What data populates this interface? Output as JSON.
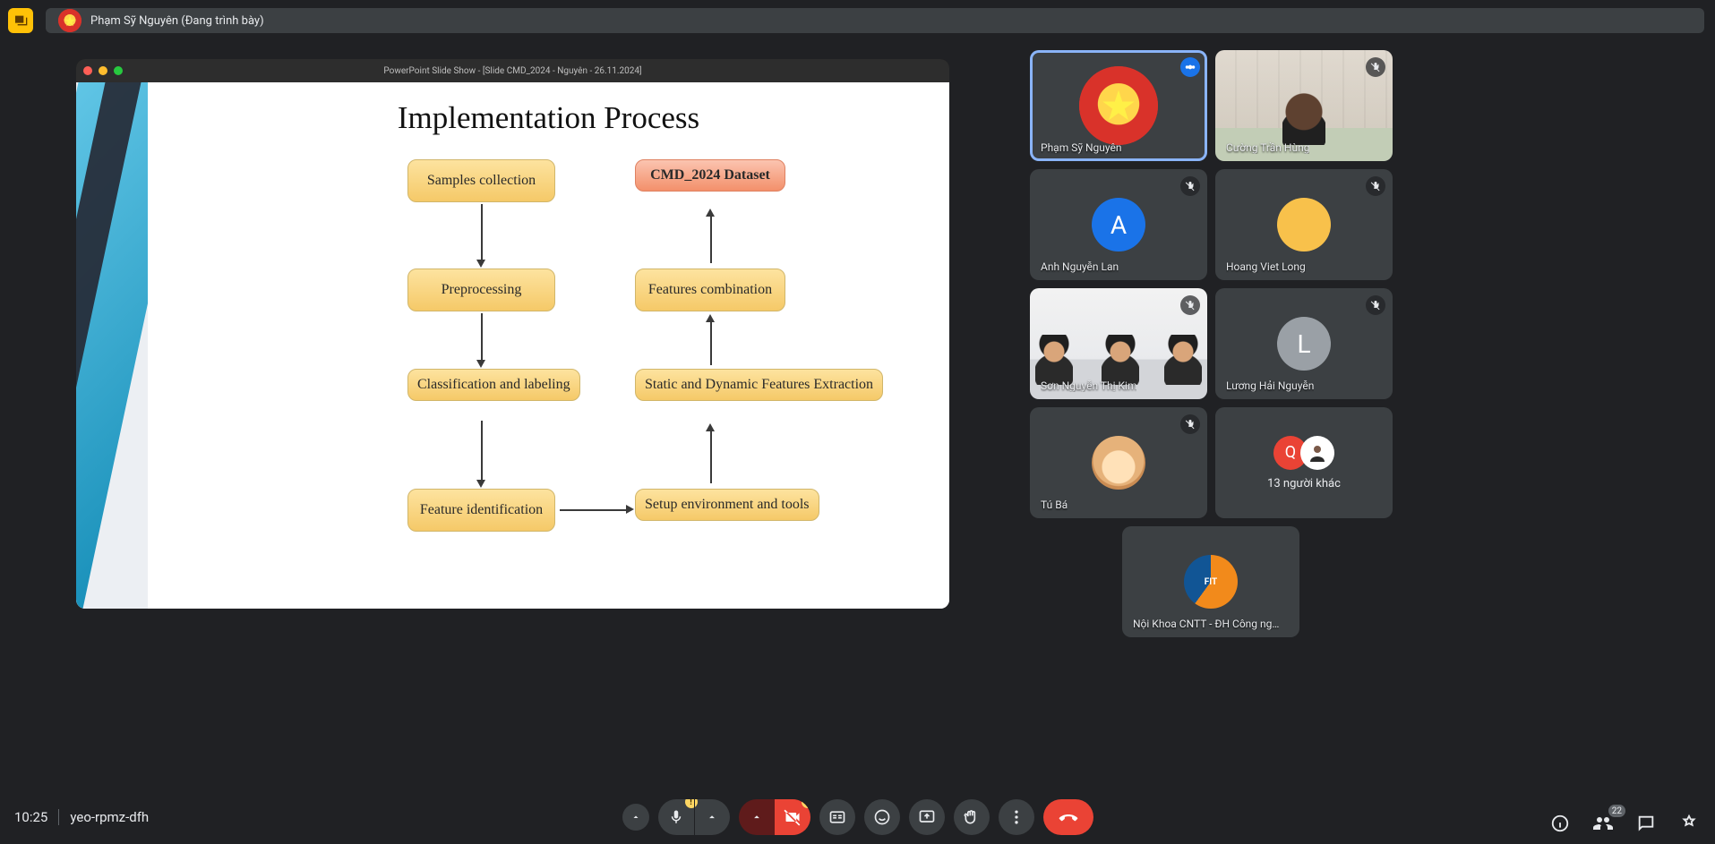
{
  "header": {
    "presenter_label": "Phạm Sỹ Nguyên (Đang trình bày)"
  },
  "presentation": {
    "window_title": "PowerPoint Slide Show - [Slide CMD_2024 - Nguyên - 26.11.2024]",
    "slide_title": "Implementation Process",
    "boxes": {
      "samples": "Samples collection",
      "dataset": "CMD_2024 Dataset",
      "preprocess": "Preprocessing",
      "features_comb": "Features combination",
      "classify": "Classification and labeling",
      "static_dyn": "Static and Dynamic Features Extraction",
      "feature_id": "Feature identification",
      "setup": "Setup environment and tools"
    }
  },
  "participants": {
    "p1": {
      "name": "Phạm Sỹ Nguyên"
    },
    "p2": {
      "name": "Cường Trần Hùng"
    },
    "p3": {
      "name": "Anh Nguyễn Lan",
      "letter": "A"
    },
    "p4": {
      "name": "Hoang Viet Long"
    },
    "p5": {
      "name": "Sơn Nguyễn Thị Kim"
    },
    "p6": {
      "name": "Lương Hải Nguyễn",
      "letter": "L"
    },
    "p7": {
      "name": "Tú Bá"
    },
    "overflow": {
      "letter": "Q",
      "text": "13 người khác"
    },
    "p9": {
      "name": "Nội Khoa CNTT - ĐH Công ng…",
      "logo_text": "FIT"
    }
  },
  "footer": {
    "clock": "10:25",
    "meeting_code": "yeo-rpmz-dfh",
    "participant_count": "22"
  }
}
